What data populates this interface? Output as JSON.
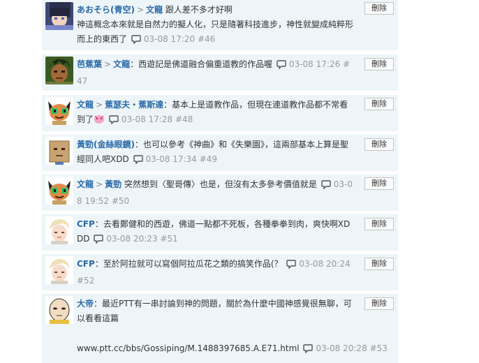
{
  "delete_label": "刪除",
  "comments": [
    {
      "user": "あおそら(青空)",
      "reply_to": "文龍",
      "text": "跟人差不多才好啊",
      "text2": "神這概念本來就是自然力的擬人化，只是隨著科技進步，神性就變成純粹形而上的東西了",
      "time": "03-08 17:20",
      "num": "#46"
    },
    {
      "user": "芭蕉葉",
      "reply_to": "文龍",
      "text": "：西遊記是佛道融合偏重道教的作品喔",
      "time": "03-08 17:26",
      "num": "#47"
    },
    {
      "user": "文龍",
      "reply_to": "蕉瑟夫・蕉斯達",
      "text": "：基本上是道教作品，但現在連道教作品都不常看到了",
      "time": "03-08 17:28",
      "num": "#48"
    },
    {
      "user": "黃勁(金絲眼鏡)",
      "text": "：也可以參考《神曲》和《失樂園》，這兩部基本上算是聖經同人吧XDD",
      "time": "03-08 17:34",
      "num": "#49"
    },
    {
      "user": "文龍",
      "reply_to": "黃勁",
      "text": "突然想到〈聖哥傳〉也是，但沒有太多參考價值就是",
      "time": "03-08 19:52",
      "num": "#50"
    },
    {
      "user": "CFP",
      "text": "：去看鄭健和的西遊，佛道一點都不死板，各種拳拳到肉，爽快啊XDDD",
      "time": "03-08 20:23",
      "num": "#51"
    },
    {
      "user": "CFP",
      "text": "：至於阿拉就可以寫個阿拉瓜花之類的搞笑作品(？",
      "time": "03-08 20:24",
      "num": "#52"
    },
    {
      "user": "大帝",
      "text": "：最近PTT有一串討論到神的問題，關於為什麼中國神感覺很無聊，可以看看這篇",
      "link": "www.ptt.cc/bbs/Gossiping/M.1488397685.A.E71.html",
      "time": "03-08 20:28",
      "num": "#53"
    }
  ]
}
